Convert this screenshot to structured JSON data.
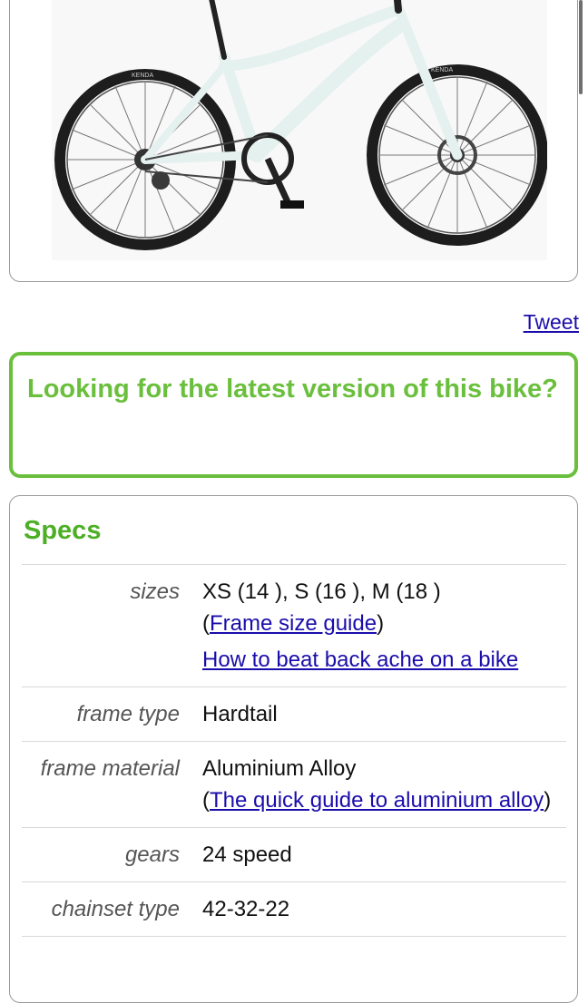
{
  "bike_image": {
    "tire_brand_left": "KENDA",
    "tire_brand_right": "KENDA",
    "frame_color": "#e4f1ef"
  },
  "tweet": "Tweet",
  "promo": {
    "title": "Looking for the latest version of this bike?"
  },
  "specs": {
    "title": "Specs",
    "rows": [
      {
        "label": "sizes",
        "value": "XS (14 ), S (16 ), M (18 )",
        "paren_open": "(",
        "link1": "Frame size guide",
        "paren_close": ")",
        "link2": "How to beat back ache on a bike"
      },
      {
        "label": "frame type",
        "value": "Hardtail"
      },
      {
        "label": "frame material",
        "value": "Aluminium Alloy",
        "paren_open": "(",
        "link1": "The quick guide to aluminium alloy",
        "paren_close": ")"
      },
      {
        "label": "gears",
        "value": "24 speed"
      },
      {
        "label": "chainset type",
        "value": "42-32-22"
      }
    ]
  },
  "colors": {
    "green": "#6abf3c",
    "link": "#1a0dab"
  }
}
